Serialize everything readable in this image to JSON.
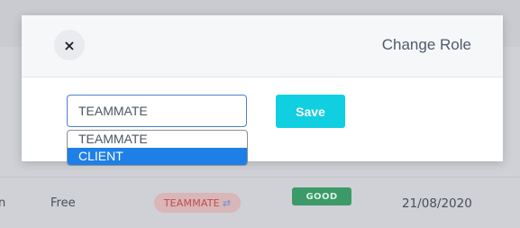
{
  "modal": {
    "title": "Change Role",
    "close_icon": "×",
    "role_select": {
      "value": "TEAMMATE",
      "options": [
        "TEAMMATE",
        "CLIENT"
      ],
      "highlighted": "CLIENT"
    },
    "save_label": "Save"
  },
  "background_row": {
    "plan": "Free",
    "role": "TEAMMATE",
    "role_icon": "⇄",
    "status": "GOOD",
    "date": "21/08/2020",
    "leading_text": "n"
  },
  "colors": {
    "accent": "#10cfe0",
    "select_border": "#4a7fd1",
    "option_highlight": "#1e7fe6",
    "status_good": "#3b9a67",
    "role_pill": "#d9b6b7"
  }
}
